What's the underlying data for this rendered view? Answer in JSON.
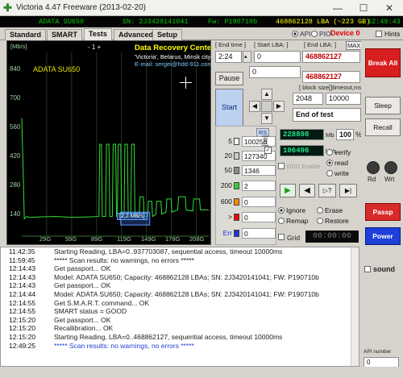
{
  "window": {
    "title": "Victoria 4.47  Freeware (2013-02-20)",
    "minimize": "—",
    "maximize": "☐",
    "close": "✕"
  },
  "infobar": {
    "model": "ADATA SU650",
    "serial": "SN: 2J3420141041",
    "firmware": "Fw: P190710b",
    "capacity": "468862128 LBA (~223 GB)",
    "clock": "12:49:43"
  },
  "tabs": [
    "Standard",
    "SMART",
    "Tests",
    "Advanced",
    "Setup"
  ],
  "active_tab": "Tests",
  "mode": {
    "api_label": "API",
    "pio_label": "PIO",
    "device_label": "Device 0",
    "hints_label": "Hints"
  },
  "graph": {
    "unit": "[Mb/s]",
    "page_ctrl": "-   1   +",
    "drive_name": "ADATA SU650",
    "ad_line1": "Data Recovery Center:",
    "ad_line2": "'Victoria', Belarus, Minsk city",
    "ad_line3": "E-mail: sergei@hdd-911.com",
    "y_labels": [
      "840",
      "700",
      "560",
      "420",
      "280",
      "140"
    ],
    "x_labels": [
      "29G",
      "59G",
      "89G",
      "119G",
      "149G",
      "178G",
      "208G"
    ],
    "speed_label": "[2,2 MB/s]"
  },
  "chart_data": {
    "type": "line",
    "ylim": [
      0,
      840
    ],
    "xlim": [
      0,
      223
    ],
    "ylabel": "[Mb/s]",
    "series": [
      {
        "x": [
          0,
          2,
          3,
          6,
          10,
          20,
          40,
          60,
          80,
          92,
          93,
          95,
          96,
          100,
          101,
          104,
          105,
          108,
          109,
          112,
          113,
          114,
          115,
          118,
          119,
          122,
          123,
          126,
          127,
          130,
          131,
          134,
          135,
          140,
          141,
          145,
          146,
          150,
          151,
          155,
          156,
          160,
          161,
          166,
          167,
          172,
          173,
          178,
          179,
          186,
          187,
          195,
          196,
          204,
          205,
          212,
          213,
          223
        ],
        "y": [
          540,
          250,
          80,
          90,
          85,
          88,
          90,
          86,
          88,
          90,
          420,
          420,
          90,
          90,
          420,
          420,
          90,
          90,
          420,
          420,
          90,
          90,
          420,
          420,
          90,
          90,
          420,
          420,
          90,
          90,
          420,
          420,
          90,
          90,
          180,
          180,
          90,
          90,
          160,
          160,
          90,
          100,
          160,
          160,
          100,
          110,
          170,
          170,
          110,
          120,
          180,
          180,
          120,
          115,
          170,
          170,
          120,
          120
        ]
      }
    ]
  },
  "controls": {
    "end_time_label": "[ End time ]",
    "start_lba_label": "[ Start LBA: ]",
    "end_lba_label": "[ End LBA: ]",
    "max_label": "MAX",
    "end_time_value": "2:24",
    "start_lba_value": "0",
    "start_lba_right": "468862127",
    "second_value": "0",
    "end_lba_value": "468862127",
    "pause_label": "Pause",
    "start_label": "Start",
    "block_size_label": "[ block size ]",
    "timeout_label": "[ timeout,ms ]",
    "block_size_value": "2048",
    "timeout_value": "10000",
    "end_of_test": "End of test"
  },
  "timing": {
    "rs_label": "RS",
    "side_label": "[oq]",
    "rows": [
      {
        "label": "5",
        "count": "100250",
        "color": "#ffffff"
      },
      {
        "label": "20",
        "count": "127340",
        "color": "#cfcfcf"
      },
      {
        "label": "50",
        "count": "1346",
        "color": "#8e8e8e"
      },
      {
        "label": "200",
        "count": "2",
        "color": "#2fd12f"
      },
      {
        "label": "600",
        "count": "0",
        "color": "#ff8a00"
      },
      {
        "label": ">",
        "count": "0",
        "color": "#ff0000"
      },
      {
        "label": "Err",
        "count": "0",
        "color": "#1a36d6"
      }
    ]
  },
  "stats": {
    "mb": "228898",
    "mb_unit": "Mb",
    "percent": "100",
    "percent_unit": "%",
    "speed": "106496",
    "speed_unit": "kb/s",
    "ddd_label": "DDD Enable",
    "verify": "verify",
    "read": "read",
    "write": "write",
    "ignore": "Ignore",
    "erase": "Erase",
    "remap": "Remap",
    "restore": "Restore",
    "grid": "Grid",
    "elapsed": "00:00:00"
  },
  "side": {
    "break_all": "Break All",
    "sleep": "Sleep",
    "recall": "Recall",
    "rd": "Rd",
    "wrt": "Wrt",
    "passp": "Passp",
    "power": "Power",
    "sound": "sound",
    "api_number_label": "API number",
    "api_number": "0"
  },
  "log": [
    {
      "time": "11:42:35",
      "msg": "Starting Reading, LBA=0..937703087, sequential access, timeout 10000ms",
      "color": "#222222"
    },
    {
      "time": "11:59:45",
      "msg": "***** Scan results: no warnings, no errors *****",
      "color": "#222222"
    },
    {
      "time": "12:14:43",
      "msg": "Get passport... OK",
      "color": "#222222"
    },
    {
      "time": "12:14:43",
      "msg": "Model: ADATA SU650; Capacity: 468862128 LBAs; SN: 2J3420141041; FW: P190710b",
      "color": "#222222"
    },
    {
      "time": "12:14:43",
      "msg": "Get passport... OK",
      "color": "#222222"
    },
    {
      "time": "12:14:44",
      "msg": "Model: ADATA SU650; Capacity: 468862128 LBAs; SN: 2J3420141041; FW: P190710b",
      "color": "#222222"
    },
    {
      "time": "12:14:55",
      "msg": "Get S.M.A.R.T. command... OK",
      "color": "#222222"
    },
    {
      "time": "12:14:55",
      "msg": "SMART status = GOOD",
      "color": "#222222"
    },
    {
      "time": "12:15:20",
      "msg": "Get passport... OK",
      "color": "#222222"
    },
    {
      "time": "12:15:20",
      "msg": "Recallibration... OK",
      "color": "#222222"
    },
    {
      "time": "12:15:20",
      "msg": "Starting Reading, LBA=0..468862127, sequential access, timeout 10000ms",
      "color": "#222222"
    },
    {
      "time": "12:49:25",
      "msg": "***** Scan results: no warnings, no errors *****",
      "color": "#1f3fd0"
    }
  ]
}
